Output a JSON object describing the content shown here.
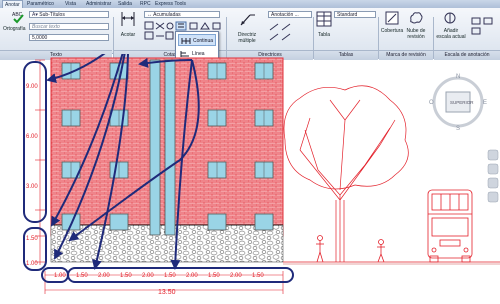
{
  "tabs": [
    "Anotar",
    "Paramétrico",
    "Vista",
    "Administrar",
    "Salida",
    "RPC",
    "Express Tools"
  ],
  "ribbon": {
    "ortografia": "Ortografía",
    "text_style": "Sub-Títulos",
    "search_placeholder": "Buscar texto",
    "text_height": "5,0000",
    "texto_panel": "Texto",
    "acotar": "Acotar",
    "dim_style": "Acumuladas",
    "cotas_panel": "Cotas",
    "directriz": "Directriz múltiple",
    "leader_style": "Anotación ...",
    "directrices_panel": "Directrices",
    "tabla": "Tabla",
    "table_style": "Standard",
    "tablas_panel": "Tablas",
    "cobertura": "Cobertura",
    "nube": "Nube de revisión",
    "marca_panel": "Marca de revisión",
    "escala": "Añadir escala actual",
    "escala_panel": "Escala de anotación"
  },
  "dropdown": {
    "items": [
      "Continua",
      "Línea base"
    ]
  },
  "drawing": {
    "vertical_dims": [
      "9.00",
      "6.00",
      "3.00",
      "1.50",
      "1.00"
    ],
    "horizontal_dims": [
      "1.00",
      "1.50",
      "2.00",
      "1.50",
      "2.00",
      "1.50",
      "2.00",
      "1.50",
      "2.00",
      "1.50"
    ],
    "total_dim": "13.50",
    "viewcube_label": "SUPERIOR",
    "compass": {
      "n": "N",
      "e": "E",
      "s": "S",
      "w": "O"
    }
  },
  "colors": {
    "accent_blue": "#1f2a7a",
    "brick_red": "#e0303a",
    "window_cyan": "#9ad4e6",
    "cad_red": "#e3202a"
  }
}
